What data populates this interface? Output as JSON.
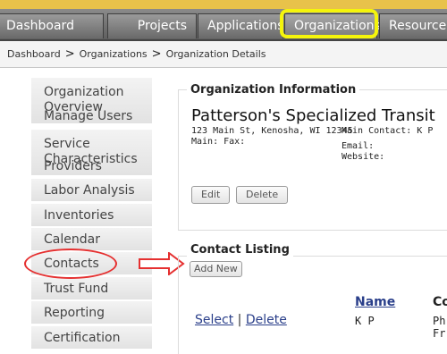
{
  "nav": {
    "tabs": [
      "Dashboard",
      "Projects",
      "Applications",
      "Organizations",
      "Resource"
    ],
    "active": "Organizations"
  },
  "breadcrumb": {
    "items": [
      "Dashboard",
      "Organizations",
      "Organization Details"
    ],
    "separator": ">"
  },
  "sidebar": {
    "items": [
      "Organization Overview",
      "Manage Users",
      "Service Characteristics",
      "Providers",
      "Labor Analysis",
      "Inventories",
      "Calendar",
      "Contacts",
      "Trust Fund",
      "Reporting",
      "Certification"
    ]
  },
  "org_info": {
    "legend": "Organization Information",
    "name": "Patterson's Specialized Transit",
    "address": "123 Main St, Kenosha, WI 12345",
    "main_contact": "Main Contact: K P",
    "main_fax": "Main:  Fax:",
    "email": "Email:",
    "website": "Website:",
    "edit_label": "Edit",
    "delete_label": "Delete"
  },
  "contacts": {
    "legend": "Contact Listing",
    "add_new_label": "Add New",
    "name_header": "Name",
    "second_header": "Co",
    "row": {
      "select": "Select",
      "sep": "|",
      "delete": "Delete",
      "name": "K P",
      "col3_line1": "Ph",
      "col3_line2": "Fr"
    }
  },
  "colors": {
    "annotation_yellow": "#f5f50b",
    "annotation_red": "#e53030",
    "link": "#2a3f8a"
  }
}
